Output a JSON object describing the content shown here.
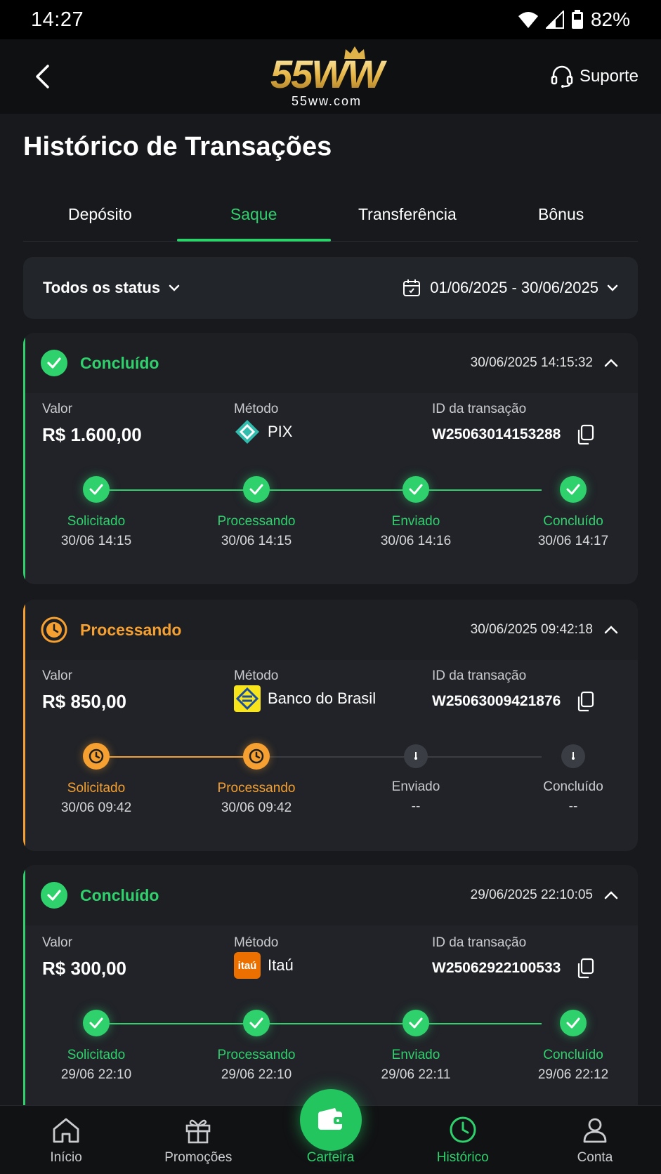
{
  "status_bar": {
    "time": "14:27",
    "battery": "82%"
  },
  "header": {
    "logo_text": "55WW",
    "logo_sub": "55ww.com",
    "support_label": "Suporte"
  },
  "page_title": "Histórico de Transações",
  "tabs": [
    {
      "label": "Depósito"
    },
    {
      "label": "Saque"
    },
    {
      "label": "Transferência"
    },
    {
      "label": "Bônus"
    }
  ],
  "active_tab": "Saque",
  "filters": {
    "status": "Todos os status",
    "date_range": "01/06/2025 - 30/06/2025"
  },
  "labels": {
    "value": "Valor",
    "method": "Método",
    "txid": "ID da transação"
  },
  "transactions": [
    {
      "status": "Concluído",
      "datetime": "30/06/2025 14:15:32",
      "value": "R$ 1.600,00",
      "method": "PIX",
      "txid": "W25063014153288",
      "steps": [
        {
          "label": "Solicitado",
          "time": "30/06 14:15"
        },
        {
          "label": "Processando",
          "time": "30/06 14:15"
        },
        {
          "label": "Enviado",
          "time": "30/06 14:16"
        },
        {
          "label": "Concluído",
          "time": "30/06 14:17"
        }
      ]
    },
    {
      "status": "Processando",
      "datetime": "30/06/2025 09:42:18",
      "value": "R$ 850,00",
      "method": "Banco do Brasil",
      "txid": "W25063009421876",
      "steps": [
        {
          "label": "Solicitado",
          "time": "30/06 09:42"
        },
        {
          "label": "Processando",
          "time": "30/06 09:42"
        },
        {
          "label": "Enviado",
          "time": "--"
        },
        {
          "label": "Concluído",
          "time": "--"
        }
      ]
    },
    {
      "status": "Concluído",
      "datetime": "29/06/2025 22:10:05",
      "value": "R$ 300,00",
      "method": "Itaú",
      "method_logo_text": "itaú",
      "txid": "W25062922100533",
      "steps": [
        {
          "label": "Solicitado",
          "time": "29/06 22:10"
        },
        {
          "label": "Processando",
          "time": "29/06 22:10"
        },
        {
          "label": "Enviado",
          "time": "29/06 22:11"
        },
        {
          "label": "Concluído",
          "time": "29/06 22:12"
        }
      ]
    }
  ],
  "bottom_nav": [
    {
      "label": "Início",
      "icon": "home-icon"
    },
    {
      "label": "Promoções",
      "icon": "gift-icon"
    },
    {
      "label": "Carteira",
      "icon": "wallet-icon"
    },
    {
      "label": "Histórico",
      "icon": "clock-icon"
    },
    {
      "label": "Conta",
      "icon": "user-icon"
    }
  ],
  "colors": {
    "accent_green": "#2fd16d",
    "accent_orange": "#f5a030",
    "background": "#17191d",
    "card": "#212328"
  }
}
